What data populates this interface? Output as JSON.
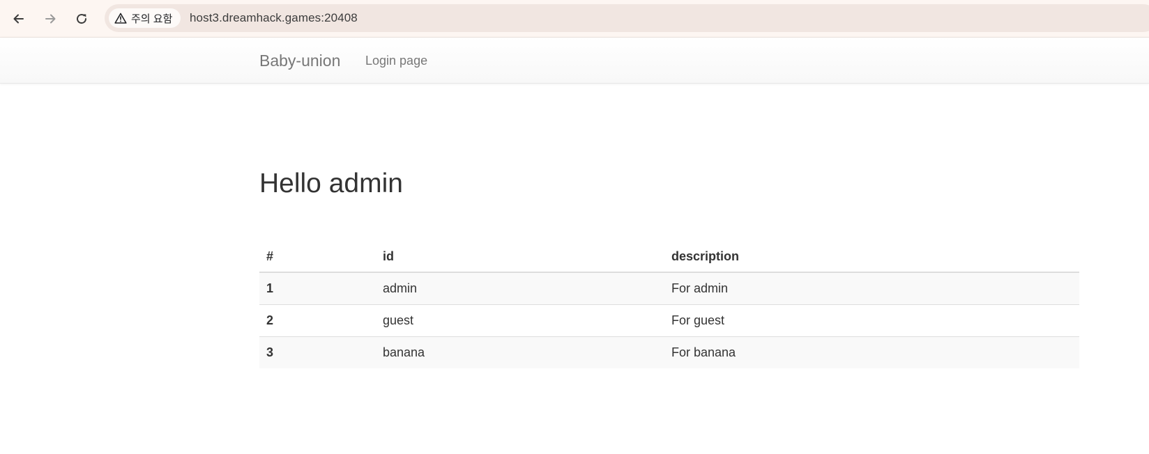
{
  "browser": {
    "security_label": "주의 요함",
    "url": "host3.dreamhack.games:20408",
    "icons": [
      "back-arrow-icon",
      "forward-arrow-icon",
      "reload-icon",
      "warning-icon"
    ]
  },
  "navbar": {
    "brand": "Baby-union",
    "links": [
      {
        "label": "Login page"
      }
    ]
  },
  "main": {
    "title": "Hello admin",
    "table": {
      "headers": [
        "#",
        "id",
        "description"
      ],
      "rows": [
        [
          "1",
          "admin",
          "For admin"
        ],
        [
          "2",
          "guest",
          "For guest"
        ],
        [
          "3",
          "banana",
          "For banana"
        ]
      ]
    }
  }
}
